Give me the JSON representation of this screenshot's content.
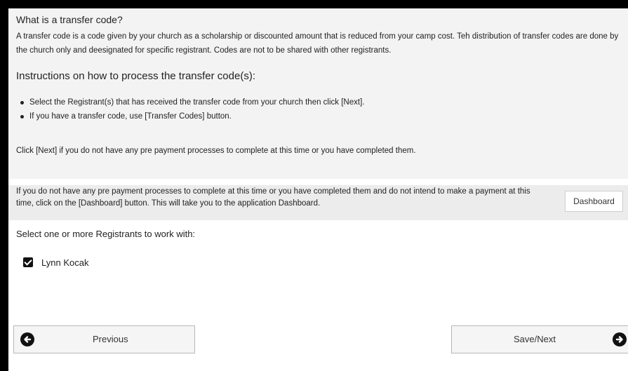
{
  "info": {
    "question_title": "What is a transfer code?",
    "description": "A transfer code is a code given by your church as a scholarship or discounted amount that is reduced from your camp cost. Teh distribution of transfer codes are done by the church only and deesignated for specific registrant. Codes are not to be shared with other registrants.",
    "instructions_title": "Instructions on how to process the transfer code(s):",
    "bullets": [
      "Select the Registrant(s) that has received the transfer code from your church then click [Next].",
      "If you have a transfer code, use [Transfer Codes] button."
    ],
    "click_next_text": "Click [Next] if you do not have any pre payment processes to complete at this time or you have completed them."
  },
  "dashboard": {
    "text": "If you do not have any pre payment processes to complete at this time or you have completed them and do not intend to make a payment at this time, click on the [Dashboard] button. This will take you to the application Dashboard.",
    "button_label": "Dashboard"
  },
  "registrants": {
    "label": "Select one or more Registrants to work with:",
    "items": [
      {
        "name": "Lynn Kocak",
        "checked": true
      }
    ]
  },
  "nav": {
    "previous_label": "Previous",
    "next_label": "Save/Next",
    "previous_icon": "arrow-left-circle-icon",
    "next_icon": "arrow-right-circle-icon"
  }
}
